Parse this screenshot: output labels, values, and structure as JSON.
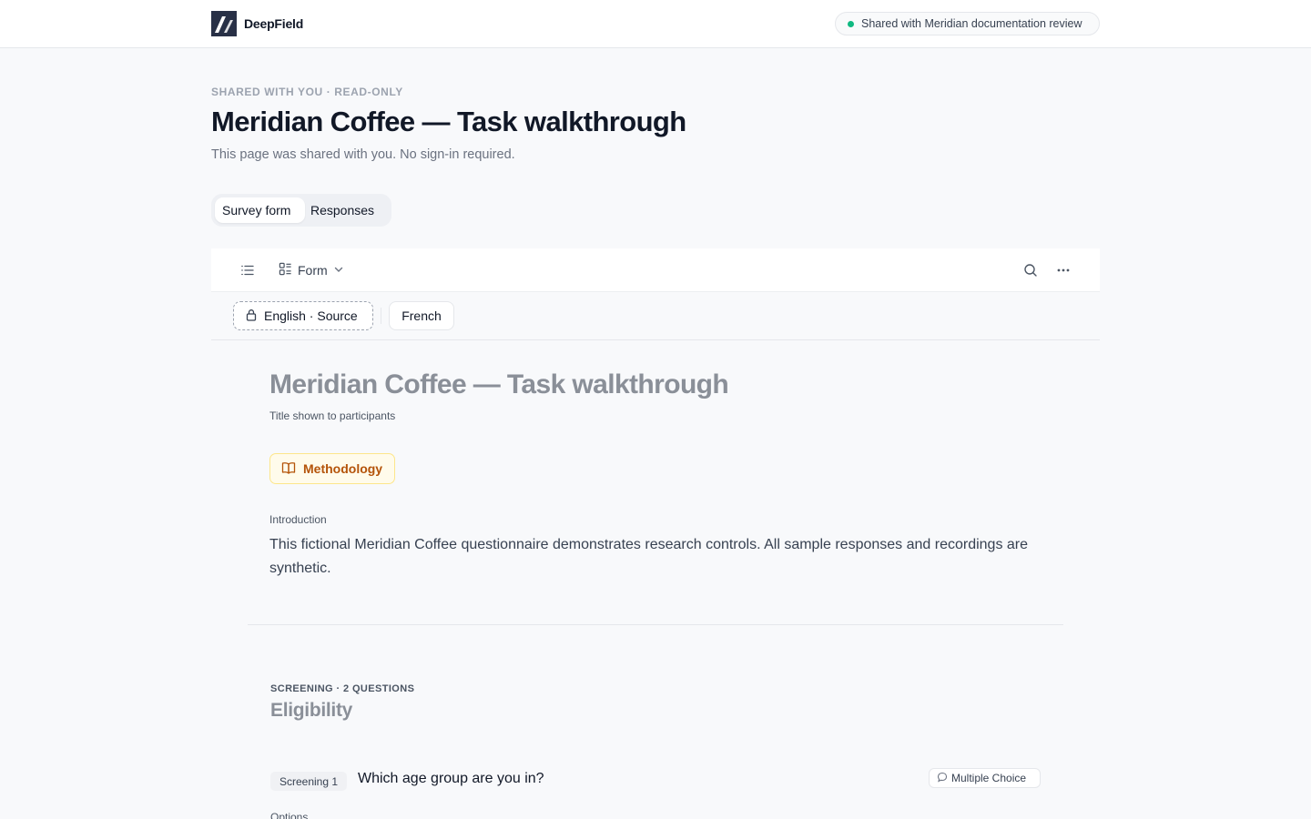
{
  "header": {
    "brand": "DeepField",
    "share_status": "Shared with Meridian documentation review"
  },
  "page": {
    "eyebrow": "SHARED WITH YOU · READ-ONLY",
    "title": "Meridian Coffee — Task walkthrough",
    "subtitle": "This page was shared with you. No sign-in required."
  },
  "tabs": [
    {
      "label": "Survey form",
      "active": true
    },
    {
      "label": "Responses",
      "active": false
    }
  ],
  "toolbar": {
    "view_label": "Form",
    "icons": [
      "list-icon",
      "form-icon",
      "chevron-down-icon",
      "search-icon",
      "more-icon"
    ]
  },
  "languages": {
    "source_label": "English · Source",
    "other_label": "French"
  },
  "survey": {
    "title": "Meridian Coffee — Task walkthrough",
    "title_hint": "Title shown to participants",
    "methodology_label": "Methodology",
    "intro_label": "Introduction",
    "intro_text": "This fictional Meridian Coffee questionnaire demonstrates research controls. All sample responses and recordings are synthetic."
  },
  "section": {
    "eyebrow": "SCREENING · 2 QUESTIONS",
    "title": "Eligibility"
  },
  "question": {
    "tag": "Screening 1",
    "text": "Which age group are you in?",
    "type": "Multiple Choice",
    "options_label": "Options"
  },
  "colors": {
    "accent_status": "#10b981",
    "methodology": "#b45309",
    "brand_mark": "#283046"
  }
}
